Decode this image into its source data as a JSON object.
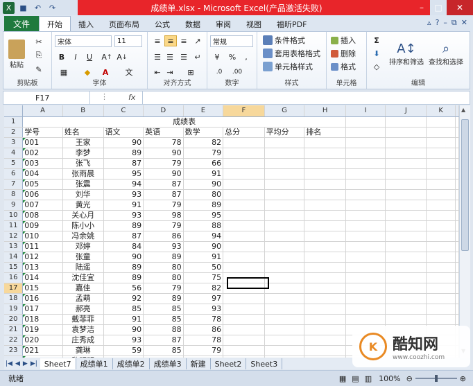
{
  "window": {
    "title": "成绩单.xlsx - Microsoft Excel(产品激活失败)"
  },
  "ribbon_tabs": {
    "file": "文件",
    "tabs": [
      "开始",
      "插入",
      "页面布局",
      "公式",
      "数据",
      "审阅",
      "视图",
      "福昕PDF"
    ]
  },
  "ribbon": {
    "clipboard": {
      "label": "剪贴板",
      "paste": "粘贴"
    },
    "font": {
      "label": "字体",
      "name": "宋体",
      "size": "11",
      "bold": "B",
      "italic": "I",
      "underline": "U"
    },
    "alignment": {
      "label": "对齐方式"
    },
    "number": {
      "label": "数字",
      "format": "常规",
      "percent": "%",
      "comma": ","
    },
    "styles": {
      "label": "样式",
      "conditional": "条件格式",
      "table": "套用表格格式",
      "cell": "单元格样式"
    },
    "cells": {
      "label": "单元格",
      "insert": "插入",
      "delete": "删除",
      "format": "格式"
    },
    "editing": {
      "label": "编辑",
      "sort": "排序和筛选",
      "find": "查找和选择",
      "sum": "Σ"
    }
  },
  "formula_bar": {
    "name_box": "F17",
    "fx": "fx",
    "value": ""
  },
  "columns": [
    "A",
    "B",
    "C",
    "D",
    "E",
    "F",
    "G",
    "H",
    "I",
    "J",
    "K"
  ],
  "sheet": {
    "title": "成绩表",
    "headers": [
      "学号",
      "姓名",
      "语文",
      "英语",
      "数学",
      "总分",
      "平均分",
      "排名"
    ],
    "rows": [
      [
        "001",
        "王家",
        "90",
        "78",
        "82"
      ],
      [
        "002",
        "李梦",
        "89",
        "90",
        "79"
      ],
      [
        "003",
        "张飞",
        "87",
        "79",
        "66"
      ],
      [
        "004",
        "张雨晨",
        "95",
        "90",
        "91"
      ],
      [
        "005",
        "张震",
        "94",
        "87",
        "90"
      ],
      [
        "006",
        "刘华",
        "93",
        "87",
        "80"
      ],
      [
        "007",
        "黄光",
        "91",
        "79",
        "89"
      ],
      [
        "008",
        "关心月",
        "93",
        "98",
        "95"
      ],
      [
        "009",
        "陈小小",
        "89",
        "79",
        "88"
      ],
      [
        "010",
        "冯余姚",
        "87",
        "86",
        "94"
      ],
      [
        "011",
        "邓婷",
        "84",
        "93",
        "90"
      ],
      [
        "012",
        "张童",
        "90",
        "89",
        "91"
      ],
      [
        "013",
        "陆遥",
        "89",
        "80",
        "50"
      ],
      [
        "014",
        "沈佳宜",
        "89",
        "80",
        "75"
      ],
      [
        "015",
        "嘉佳",
        "56",
        "79",
        "82"
      ],
      [
        "016",
        "孟萌",
        "92",
        "89",
        "97"
      ],
      [
        "017",
        "郝亮",
        "85",
        "85",
        "93"
      ],
      [
        "018",
        "戴菲菲",
        "91",
        "85",
        "78"
      ],
      [
        "019",
        "袁梦洁",
        "90",
        "88",
        "86"
      ],
      [
        "020",
        "庄秀成",
        "93",
        "87",
        "78"
      ],
      [
        "021",
        "龚琳",
        "59",
        "85",
        "79"
      ],
      [
        "022",
        "黎明明",
        "93",
        "88",
        "87"
      ]
    ]
  },
  "selected_row": 17,
  "sheet_tabs": [
    "Sheet7",
    "成绩单1",
    "成绩单2",
    "成绩单3",
    "新建",
    "Sheet2",
    "Sheet3"
  ],
  "active_sheet": "Sheet7",
  "status": {
    "mode": "就绪",
    "zoom": "100%"
  },
  "watermark": {
    "brand": "酷知网",
    "url": "www.coozhi.com"
  }
}
